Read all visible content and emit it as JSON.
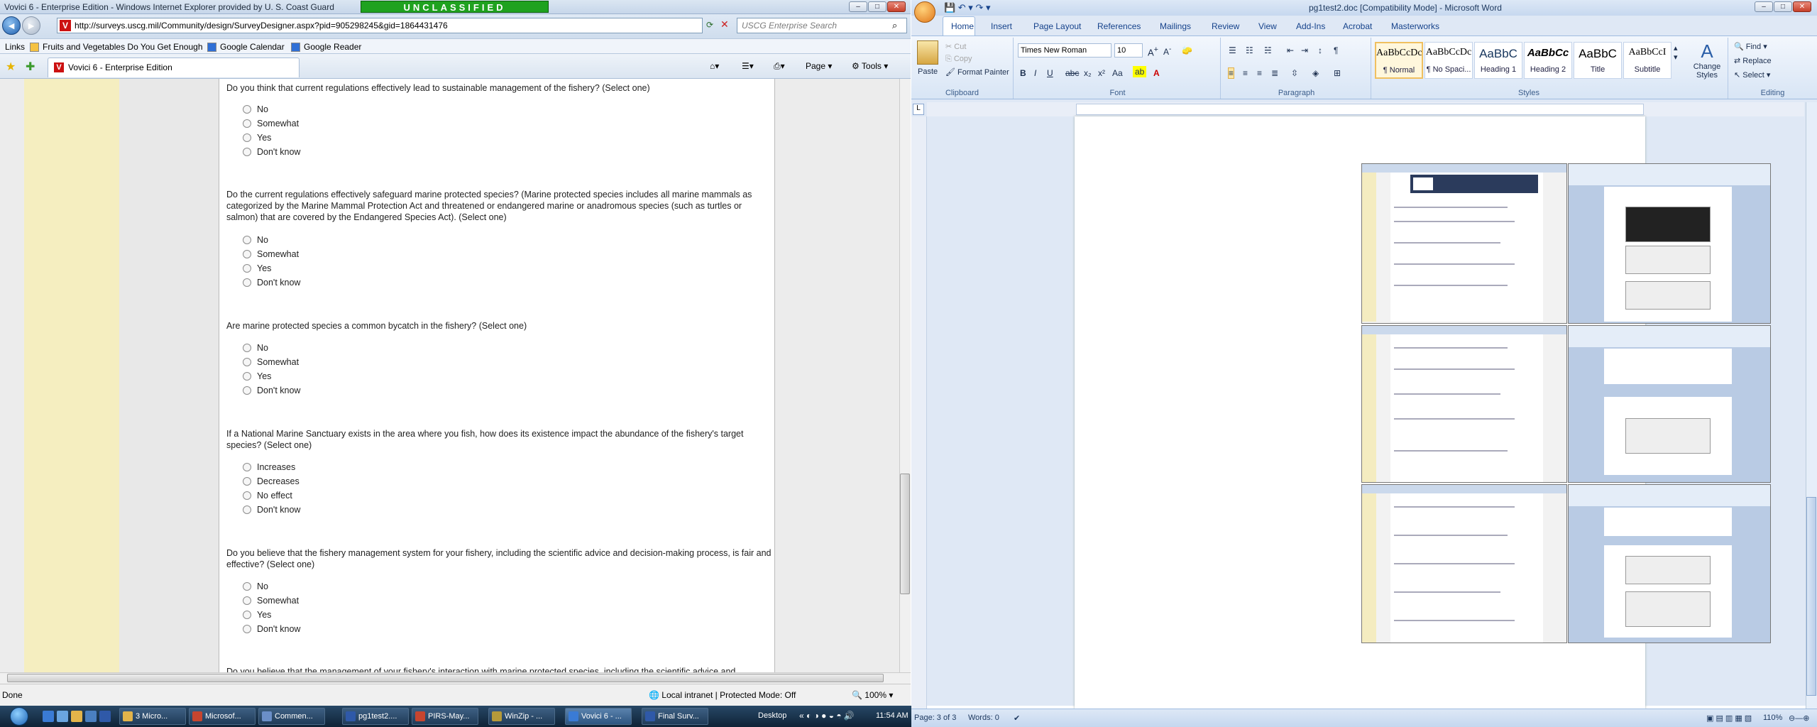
{
  "ie": {
    "title": "Vovici 6 - Enterprise Edition - Windows Internet Explorer provided by U. S. Coast Guard",
    "banner": "UNCLASSIFIED",
    "url": "http://surveys.uscg.mil/Community/design/SurveyDesigner.aspx?pid=905298245&gid=1864431476",
    "search_placeholder": "USCG Enterprise Search",
    "links_label": "Links",
    "favorites": [
      "Fruits and Vegetables Do You Get Enough",
      "Google Calendar",
      "Google Reader"
    ],
    "tab_title": "Vovici 6 - Enterprise Edition",
    "commands": {
      "page": "Page",
      "tools": "Tools"
    },
    "status_left": "Done",
    "status_zone": "Local intranet | Protected Mode: Off",
    "status_zoom": "100%"
  },
  "survey": {
    "questions": [
      {
        "text": "Do you think that current regulations effectively lead to sustainable management of the fishery? (Select one)",
        "options": [
          "No",
          "Somewhat",
          "Yes",
          "Don't know"
        ]
      },
      {
        "text": "Do the current regulations effectively safeguard marine protected species? (Marine protected species includes all marine mammals as categorized by the Marine Mammal Protection Act and threatened or endangered marine or anadromous species (such as turtles or salmon) that are covered by the Endangered Species Act). (Select one)",
        "options": [
          "No",
          "Somewhat",
          "Yes",
          "Don't know"
        ]
      },
      {
        "text": "Are marine protected species a common bycatch in the fishery? (Select one)",
        "options": [
          "No",
          "Somewhat",
          "Yes",
          "Don't know"
        ]
      },
      {
        "text": "If a National Marine Sanctuary exists in the area where you fish, how does its existence impact the abundance of the fishery's target species? (Select one)",
        "options": [
          "Increases",
          "Decreases",
          "No effect",
          "Don't know"
        ]
      },
      {
        "text": "Do you believe that the fishery management system for your fishery, including the scientific advice and decision-making process, is fair and effective? (Select one)",
        "options": [
          "No",
          "Somewhat",
          "Yes",
          "Don't know"
        ]
      },
      {
        "text": "Do you believe that the management of your fishery's interaction with marine protected species, including the scientific advice and",
        "options": []
      }
    ]
  },
  "word": {
    "title": "pg1test2.doc [Compatibility Mode] - Microsoft Word",
    "tabs": [
      "Home",
      "Insert",
      "Page Layout",
      "References",
      "Mailings",
      "Review",
      "View",
      "Add-Ins",
      "Acrobat",
      "Masterworks"
    ],
    "clipboard": {
      "paste": "Paste",
      "cut": "Cut",
      "copy": "Copy",
      "format_painter": "Format Painter",
      "label": "Clipboard"
    },
    "font": {
      "name": "Times New Roman",
      "size": "10",
      "label": "Font"
    },
    "paragraph_label": "Paragraph",
    "styles": [
      {
        "preview": "AaBbCcDc",
        "name": "¶ Normal"
      },
      {
        "preview": "AaBbCcDc",
        "name": "¶ No Spaci..."
      },
      {
        "preview": "AaBbC",
        "name": "Heading 1"
      },
      {
        "preview": "AaBbCc",
        "name": "Heading 2"
      },
      {
        "preview": "AaBbC",
        "name": "Title"
      },
      {
        "preview": "AaBbCcI",
        "name": "Subtitle"
      }
    ],
    "styles_label": "Styles",
    "change_styles": "Change Styles",
    "editing": {
      "find": "Find",
      "replace": "Replace",
      "select": "Select",
      "label": "Editing"
    },
    "status": {
      "page": "Page: 3 of 3",
      "words": "Words: 0",
      "zoom": "110%"
    }
  },
  "taskbar": {
    "buttons": [
      "3 Micro...",
      "Microsof...",
      "Commen...",
      "pg1test2....",
      "PIRS-May...",
      "WinZip - ...",
      "Vovici 6 - ...",
      "Final Surv..."
    ],
    "desktop": "Desktop",
    "clock": "11:54 AM"
  }
}
